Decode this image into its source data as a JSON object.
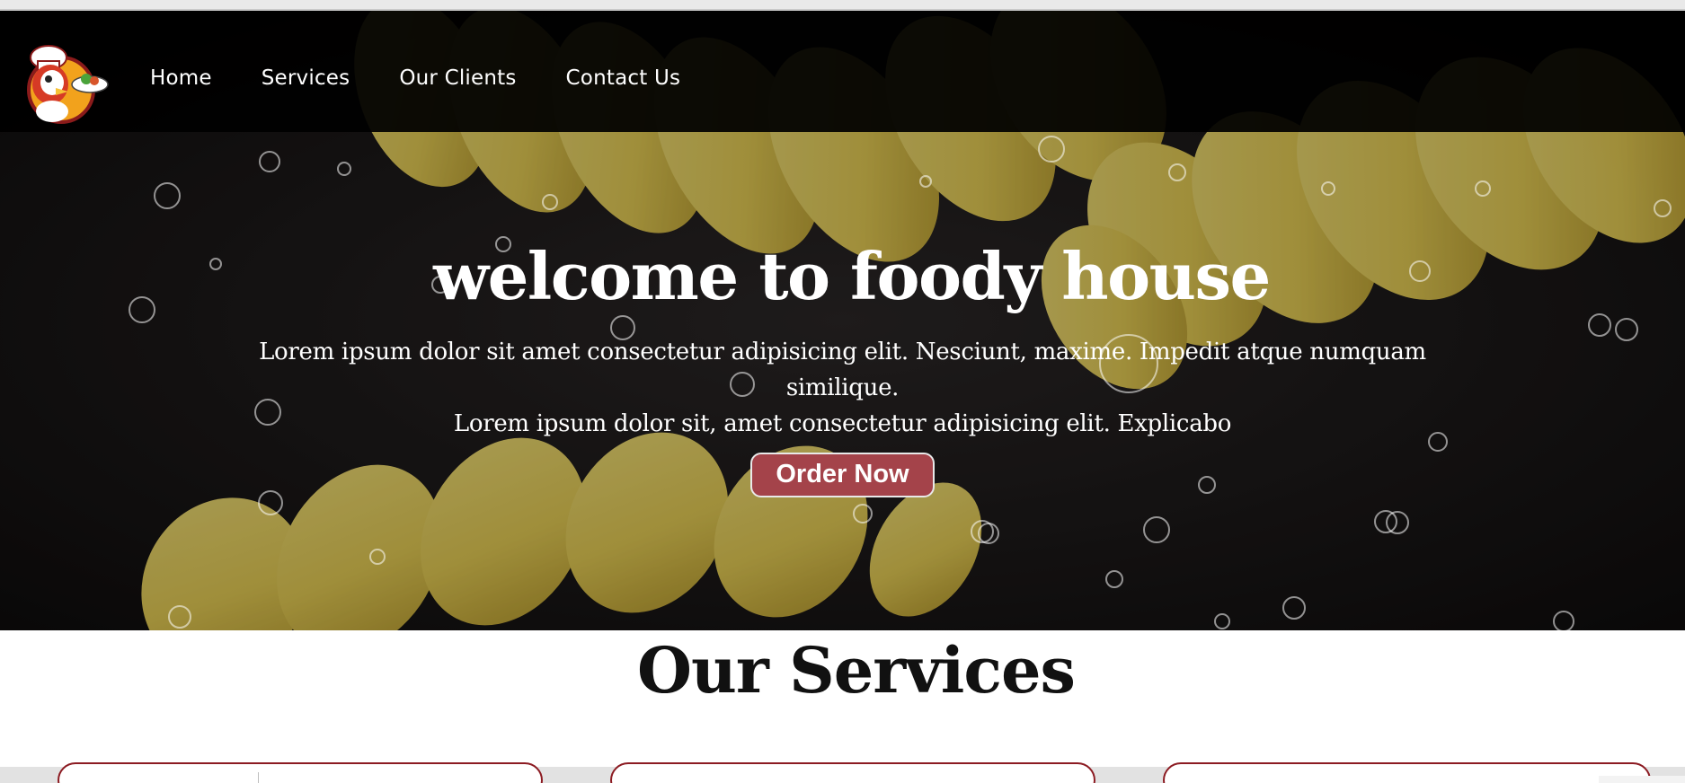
{
  "navbar": {
    "logo": "chef-rooster-logo",
    "links": [
      "Home",
      "Services",
      "Our Clients",
      "Contact Us"
    ]
  },
  "hero": {
    "title": "welcome to foody house",
    "line1": "Lorem ipsum dolor sit amet consectetur adipisicing elit. Nesciunt, maxime. Impedit atque numquam similique.",
    "line2": "Lorem ipsum dolor sit, amet consectetur adipisicing elit. Explicabo",
    "button": "Order Now"
  },
  "services": {
    "title": "Our Services"
  },
  "colors": {
    "accent": "#a4434a",
    "card_border": "#8c1b22",
    "nav_bg": "#000000"
  }
}
